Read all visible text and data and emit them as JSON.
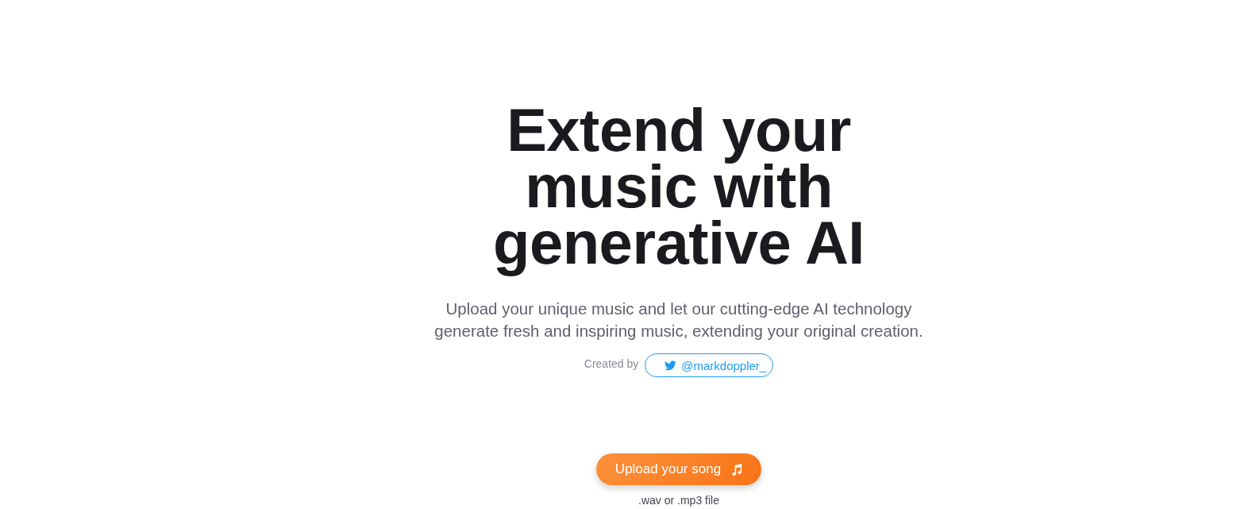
{
  "hero": {
    "title": "Extend your music with generative AI",
    "subtitle": "Upload your unique music and let our cutting-edge AI technology generate fresh and inspiring music, extending your original creation."
  },
  "credit": {
    "label": "Created by",
    "handle": "@markdoppler_"
  },
  "upload": {
    "button": "Upload your song",
    "hint": ".wav or .mp3 file"
  }
}
